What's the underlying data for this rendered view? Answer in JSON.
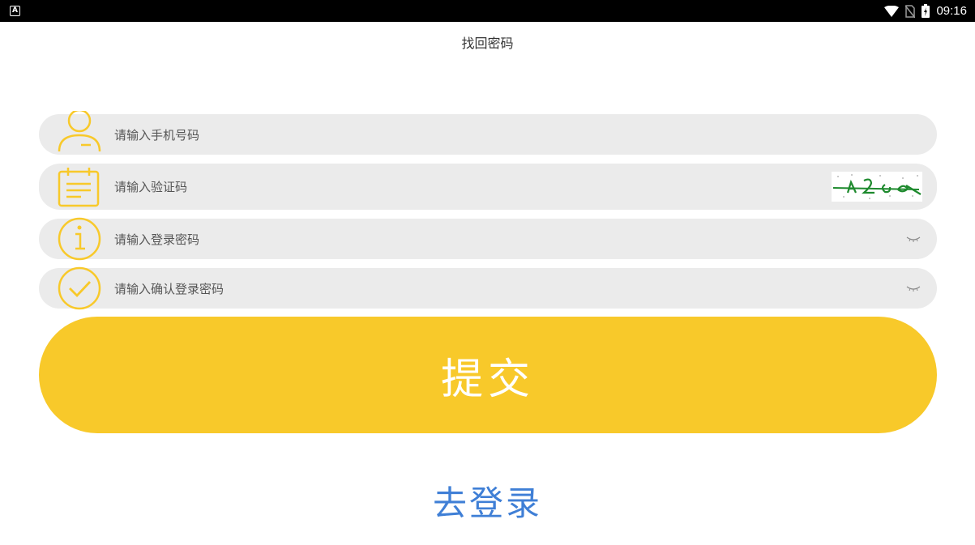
{
  "status_bar": {
    "time": "09:16",
    "left_icon": "A",
    "icons": [
      "wifi-icon",
      "no-sim-icon",
      "battery-icon"
    ]
  },
  "title": "找回密码",
  "fields": {
    "phone": {
      "placeholder": "请输入手机号码",
      "icon": "user-icon"
    },
    "code": {
      "placeholder": "请输入验证码",
      "icon": "calendar-note-icon"
    },
    "password": {
      "placeholder": "请输入登录密码",
      "icon": "info-circle-icon"
    },
    "confirm": {
      "placeholder": "请输入确认登录密码",
      "icon": "check-circle-icon"
    }
  },
  "submit_label": "提交",
  "login_label": "去登录",
  "colors": {
    "accent": "#f8c92a",
    "link": "#3f7fd6",
    "field_bg": "#ebebeb",
    "captcha_text": "#1e8a2e"
  }
}
